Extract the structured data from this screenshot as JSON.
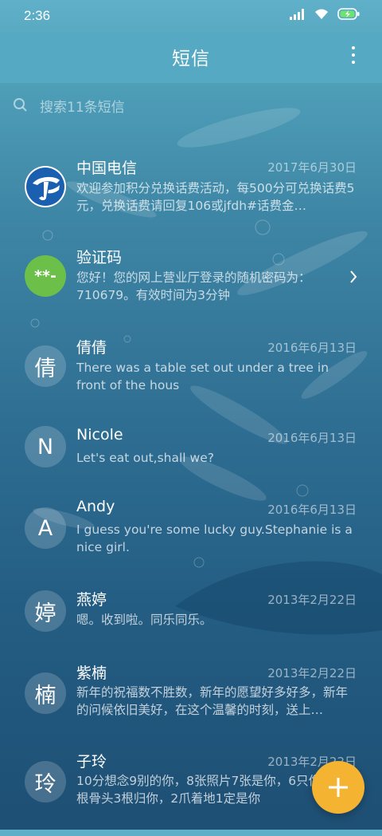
{
  "status": {
    "time": "2:36"
  },
  "header": {
    "title": "短信"
  },
  "search": {
    "placeholder": "搜索11条短信"
  },
  "conversations": [
    {
      "name": "中国电信",
      "date": "2017年6月30日",
      "snippet": "欢迎参加积分兑换话费活动，每500分可兑换话费5元，兑换话费请回复106或jfdh#话费金…",
      "avatar": "china-telecom-logo"
    },
    {
      "name": "验证码",
      "date": "",
      "snippet": "您好！您的网上营业厅登录的随机密码为：710679。有效时间为3分钟",
      "avatar_text": "**-"
    },
    {
      "name": "倩倩",
      "date": "2016年6月13日",
      "snippet": "There was a table set out under a tree in front of the hous",
      "avatar_text": "倩"
    },
    {
      "name": "Nicole",
      "date": "2016年6月13日",
      "snippet": "Let's eat out,shall we?",
      "avatar_text": "N"
    },
    {
      "name": "Andy",
      "date": "2016年6月13日",
      "snippet": "I guess you're some lucky guy.Stephanie is a nice girl.",
      "avatar_text": "A"
    },
    {
      "name": "燕婷",
      "date": "2013年2月22日",
      "snippet": "嗯。收到啦。同乐同乐。",
      "avatar_text": "婷"
    },
    {
      "name": "紫楠",
      "date": "2013年2月22日",
      "snippet": "新年的祝福数不胜数，新年的愿望好多好多，新年的问候依旧美好，在这个温馨的时刻，送上…",
      "avatar_text": "楠"
    },
    {
      "name": "子玲",
      "date": "2013年2月22日",
      "snippet": "10分想念9别的你，8张照片7张是你，6只像你，4根骨头3根归你，2爪着地1定是你",
      "avatar_text": "玲"
    }
  ],
  "colors": {
    "accent": "#f4b431",
    "verify_green": "#6cc04a",
    "header": "#56a9c3"
  }
}
